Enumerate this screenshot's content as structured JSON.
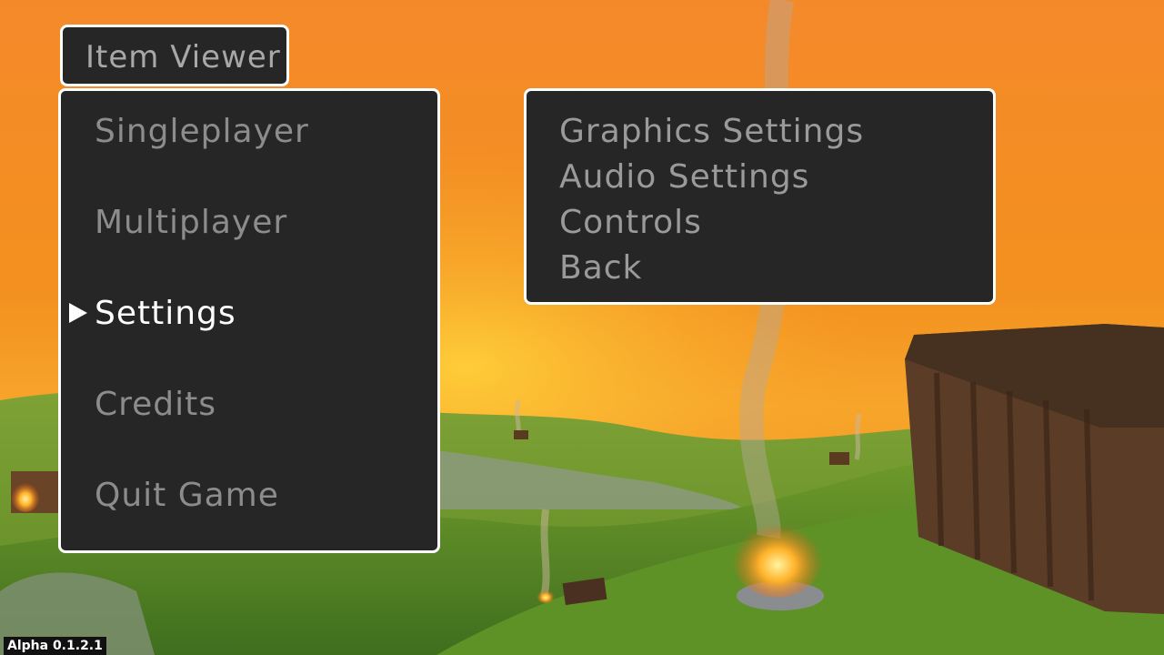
{
  "header": {
    "item_viewer_label": "Item Viewer"
  },
  "main_menu": {
    "items": [
      {
        "label": "Singleplayer"
      },
      {
        "label": "Multiplayer"
      },
      {
        "label": "Settings"
      },
      {
        "label": "Credits"
      },
      {
        "label": "Quit Game"
      }
    ],
    "selected_index": 2
  },
  "settings_menu": {
    "items": [
      {
        "label": "Graphics Settings"
      },
      {
        "label": "Audio Settings"
      },
      {
        "label": "Controls"
      },
      {
        "label": "Back"
      }
    ]
  },
  "footer": {
    "version": "Alpha 0.1.2.1"
  },
  "colors": {
    "panel_bg": "#262626",
    "panel_border": "#ffffff",
    "item_text": "#8c8c8c",
    "selected_text": "#ffffff",
    "sky_top": "#f08a1e",
    "grass": "#6a9a2a"
  },
  "icons": {
    "selection_cursor": "triangle-right-icon"
  }
}
